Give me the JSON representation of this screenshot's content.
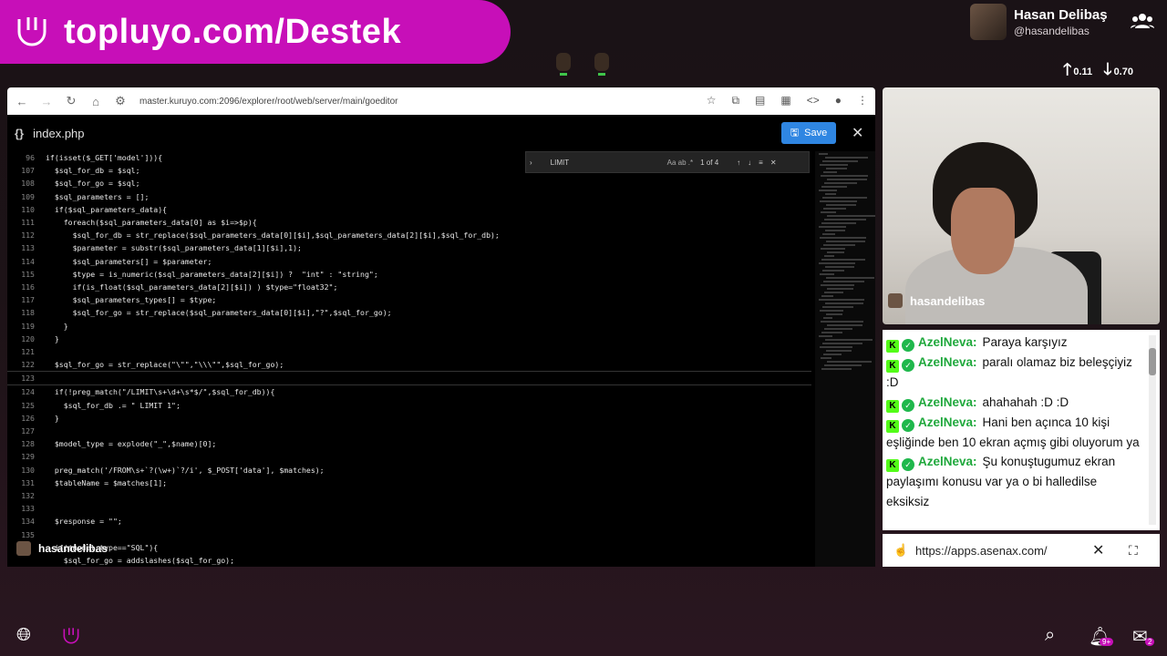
{
  "banner": {
    "title": "topluyo.com/Destek"
  },
  "profile": {
    "name": "Hasan Delibaş",
    "handle": "@hasandelibas"
  },
  "stats": {
    "up": "0.11",
    "down": "0.70"
  },
  "browser": {
    "url": "master.kuruyo.com:2096/explorer/root/web/server/main/goeditor"
  },
  "editor": {
    "file_name": "index.php",
    "save_label": "Save",
    "find": {
      "query": "LIMIT",
      "count": "1 of 4"
    },
    "lines": [
      {
        "n": "96",
        "t": "if(isset($_GET['model'])){"
      },
      {
        "n": "107",
        "t": "  $sql_for_db = $sql;"
      },
      {
        "n": "108",
        "t": "  $sql_for_go = $sql;"
      },
      {
        "n": "109",
        "t": "  $sql_parameters = [];"
      },
      {
        "n": "110",
        "t": "  if($sql_parameters_data){"
      },
      {
        "n": "111",
        "t": "    foreach($sql_parameters_data[0] as $i=>$p){"
      },
      {
        "n": "112",
        "t": "      $sql_for_db = str_replace($sql_parameters_data[0][$i],$sql_parameters_data[2][$i],$sql_for_db);"
      },
      {
        "n": "113",
        "t": "      $parameter = substr($sql_parameters_data[1][$i],1);"
      },
      {
        "n": "114",
        "t": "      $sql_parameters[] = $parameter;"
      },
      {
        "n": "115",
        "t": "      $type = is_numeric($sql_parameters_data[2][$i]) ?  \"int\" : \"string\";"
      },
      {
        "n": "116",
        "t": "      if(is_float($sql_parameters_data[2][$i]) ) $type=\"float32\";"
      },
      {
        "n": "117",
        "t": "      $sql_parameters_types[] = $type;"
      },
      {
        "n": "118",
        "t": "      $sql_for_go = str_replace($sql_parameters_data[0][$i],\"?\",$sql_for_go);"
      },
      {
        "n": "119",
        "t": "    }"
      },
      {
        "n": "120",
        "t": "  }"
      },
      {
        "n": "121",
        "t": ""
      },
      {
        "n": "122",
        "t": "  $sql_for_go = str_replace(\"\\\"\",\"\\\\\\\"\",$sql_for_go);"
      },
      {
        "n": "123",
        "t": "  "
      },
      {
        "n": "124",
        "t": "  if(!preg_match(\"/LIMIT\\s+\\d+\\s*$/\",$sql_for_db)){"
      },
      {
        "n": "125",
        "t": "    $sql_for_db .= \" LIMIT 1\";"
      },
      {
        "n": "126",
        "t": "  }"
      },
      {
        "n": "127",
        "t": ""
      },
      {
        "n": "128",
        "t": "  $model_type = explode(\"_\",$name)[0];"
      },
      {
        "n": "129",
        "t": ""
      },
      {
        "n": "130",
        "t": "  preg_match('/FROM\\s+`?(\\w+)`?/i', $_POST['data'], $matches);"
      },
      {
        "n": "131",
        "t": "  $tableName = $matches[1];"
      },
      {
        "n": "132",
        "t": ""
      },
      {
        "n": "133",
        "t": ""
      },
      {
        "n": "134",
        "t": "  $response = \"\";"
      },
      {
        "n": "135",
        "t": ""
      },
      {
        "n": "",
        "t": "  if($model_type==\"SQL\"){"
      },
      {
        "n": "",
        "t": "    $sql_for_go = addslashes($sql_for_go);"
      }
    ]
  },
  "overlay_user": "hasandelibas",
  "cam_user": "hasandelibas",
  "chat": {
    "messages": [
      {
        "user": "AzelNeva:",
        "text": "Paraya karşıyız"
      },
      {
        "user": "AzelNeva:",
        "text": "paralı olamaz biz beleşçiyiz :D"
      },
      {
        "user": "AzelNeva:",
        "text": "ahahahah :D :D"
      },
      {
        "user": "AzelNeva:",
        "text": "Hani ben açınca 10 kişi eşliğinde ben 10 ekran açmış gibi oluyorum ya"
      },
      {
        "user": "AzelNeva:",
        "text": "Şu konuştugumuz ekran paylaşımı konusu var ya o bi halledilse eksiksiz"
      }
    ]
  },
  "link": "https://apps.asenax.com/",
  "notifications": {
    "bell_badge": "9+",
    "mail_badge": "2"
  },
  "colors": {
    "brand": "#c70fb8",
    "save": "#2f86e2",
    "chat_user": "#1fa83c"
  }
}
